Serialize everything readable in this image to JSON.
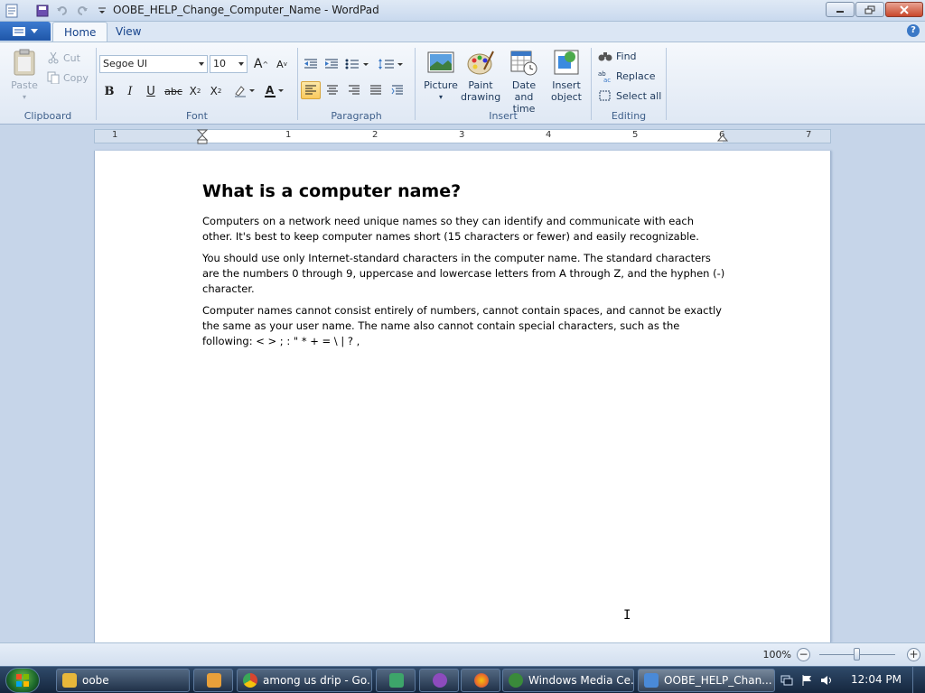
{
  "window": {
    "title": "OOBE_HELP_Change_Computer_Name - WordPad"
  },
  "tabs": {
    "home": "Home",
    "view": "View"
  },
  "ribbon": {
    "clipboard": {
      "label": "Clipboard",
      "paste": "Paste",
      "cut": "Cut",
      "copy": "Copy"
    },
    "font": {
      "label": "Font",
      "family": "Segoe UI",
      "size": "10",
      "bold": "B",
      "italic": "I",
      "underline": "U",
      "strikethrough": "abc"
    },
    "paragraph": {
      "label": "Paragraph"
    },
    "insert": {
      "label": "Insert",
      "picture": "Picture",
      "paint_drawing": "Paint drawing",
      "date_time": "Date and time",
      "insert_object": "Insert object"
    },
    "editing": {
      "label": "Editing",
      "find": "Find",
      "replace": "Replace",
      "select_all": "Select all"
    }
  },
  "ruler": {
    "numbers": [
      "1",
      "1",
      "2",
      "3",
      "4",
      "5",
      "6",
      "7"
    ]
  },
  "document": {
    "heading": "What is a computer name?",
    "paragraphs": [
      "Computers on a network need unique names so they can identify and communicate with each other. It's best to keep computer names short (15 characters or fewer) and easily recognizable.",
      "You should use only Internet-standard characters in the computer name. The standard characters are the numbers 0 through 9, uppercase and lowercase letters from A through Z, and the hyphen (-) character.",
      "Computer names cannot consist entirely of numbers, cannot contain spaces, and cannot be exactly the same as your user name. The name also cannot contain special characters, such as the following: < > ; : \" * + = \\ | ? ,"
    ]
  },
  "statusbar": {
    "zoom": "100%",
    "zoom_level": 0.5
  },
  "taskbar": {
    "items": [
      {
        "label": "oobe",
        "color": "#e8b73a"
      },
      {
        "label": "",
        "color": "#e8a03a"
      },
      {
        "label": "among us drip - Go...",
        "color": "#d8452f"
      },
      {
        "label": "",
        "color": "#3da56a"
      },
      {
        "label": "",
        "color": "#8d4bbd"
      },
      {
        "label": "",
        "color": "#e86a2a"
      },
      {
        "label": "Windows Media Ce...",
        "color": "#3a8a3a"
      },
      {
        "label": "OOBE_HELP_Chan...",
        "color": "#4a8ad8"
      }
    ],
    "clock": "12:04 PM"
  },
  "colors": {
    "accent": "#1f56a8",
    "selected_align": "#f9c95e"
  }
}
